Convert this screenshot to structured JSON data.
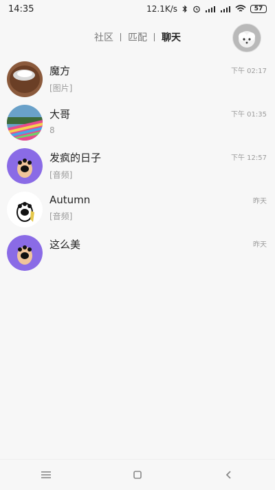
{
  "status": {
    "time": "14:35",
    "speed": "12.1K/s",
    "battery": "57"
  },
  "nav": {
    "tabs": [
      {
        "label": "社区"
      },
      {
        "label": "匹配"
      },
      {
        "label": "聊天"
      }
    ],
    "active_tab": "聊天"
  },
  "chats": [
    {
      "name": "魔方",
      "preview": "[图片]",
      "time": "下午 02:17"
    },
    {
      "name": "大哥",
      "preview": "8",
      "time": "下午 01:35"
    },
    {
      "name": "发疯的日子",
      "preview": "[音频]",
      "time": "下午 12:57"
    },
    {
      "name": "Autumn",
      "preview": "[音频]",
      "time": "昨天"
    },
    {
      "name": "这么美",
      "preview": "",
      "time": "昨天"
    }
  ],
  "colors": {
    "bg": "#f7f7f7",
    "text_primary": "#222222",
    "text_secondary": "#9a9a9a",
    "purple_avatar": "#8a6be6"
  },
  "icons": {
    "bluetooth": "bluetooth-icon",
    "alarm": "alarm-icon",
    "signal": "signal-icon",
    "wifi": "wifi-icon",
    "menu": "menu-icon",
    "home": "home-icon",
    "back": "back-icon"
  }
}
